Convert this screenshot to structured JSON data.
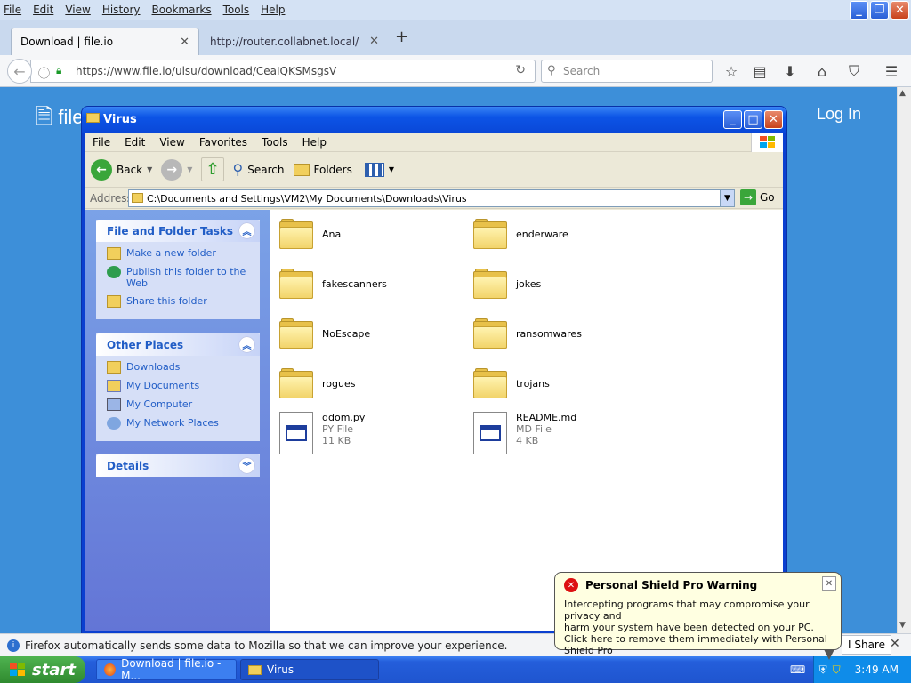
{
  "firefox": {
    "menu": [
      "File",
      "Edit",
      "View",
      "History",
      "Bookmarks",
      "Tools",
      "Help"
    ],
    "tabs": [
      {
        "label": "Download | file.io"
      },
      {
        "label": "http://router.collabnet.local/"
      }
    ],
    "url": "https://www.file.io/ulsu/download/CeaIQKSMsgsV",
    "search_placeholder": "Search",
    "notification": "Firefox automatically sends some data to Mozilla so that we can improve your experience.",
    "notification_button": "I Share"
  },
  "page": {
    "logo": "file",
    "login": "Log In"
  },
  "explorer": {
    "title": "Virus",
    "menu": [
      "File",
      "Edit",
      "View",
      "Favorites",
      "Tools",
      "Help"
    ],
    "toolbar": {
      "back": "Back",
      "search": "Search",
      "folders": "Folders"
    },
    "address_label": "Address",
    "address": "C:\\Documents and Settings\\VM2\\My Documents\\Downloads\\Virus",
    "go": "Go",
    "tasks": {
      "title": "File and Folder Tasks",
      "items": [
        "Make a new folder",
        "Publish this folder to the Web",
        "Share this folder"
      ]
    },
    "places": {
      "title": "Other Places",
      "items": [
        "Downloads",
        "My Documents",
        "My Computer",
        "My Network Places"
      ]
    },
    "details": {
      "title": "Details"
    },
    "folders": [
      "Ana",
      "enderware",
      "fakescanners",
      "jokes",
      "NoEscape",
      "ransomwares",
      "rogues",
      "trojans"
    ],
    "files": [
      {
        "name": "ddom.py",
        "type": "PY File",
        "size": "11 KB"
      },
      {
        "name": "README.md",
        "type": "MD File",
        "size": "4 KB"
      }
    ]
  },
  "taskbar": {
    "start": "start",
    "tasks": [
      "Download | file.io - M...",
      "Virus"
    ],
    "clock": "3:49 AM"
  },
  "balloon": {
    "title": "Personal Shield Pro Warning",
    "lines": [
      "Intercepting programs that may compromise your privacy and",
      "harm your system have been detected on your PC.",
      "Click here to remove them immediately with Personal Shield Pro"
    ]
  }
}
